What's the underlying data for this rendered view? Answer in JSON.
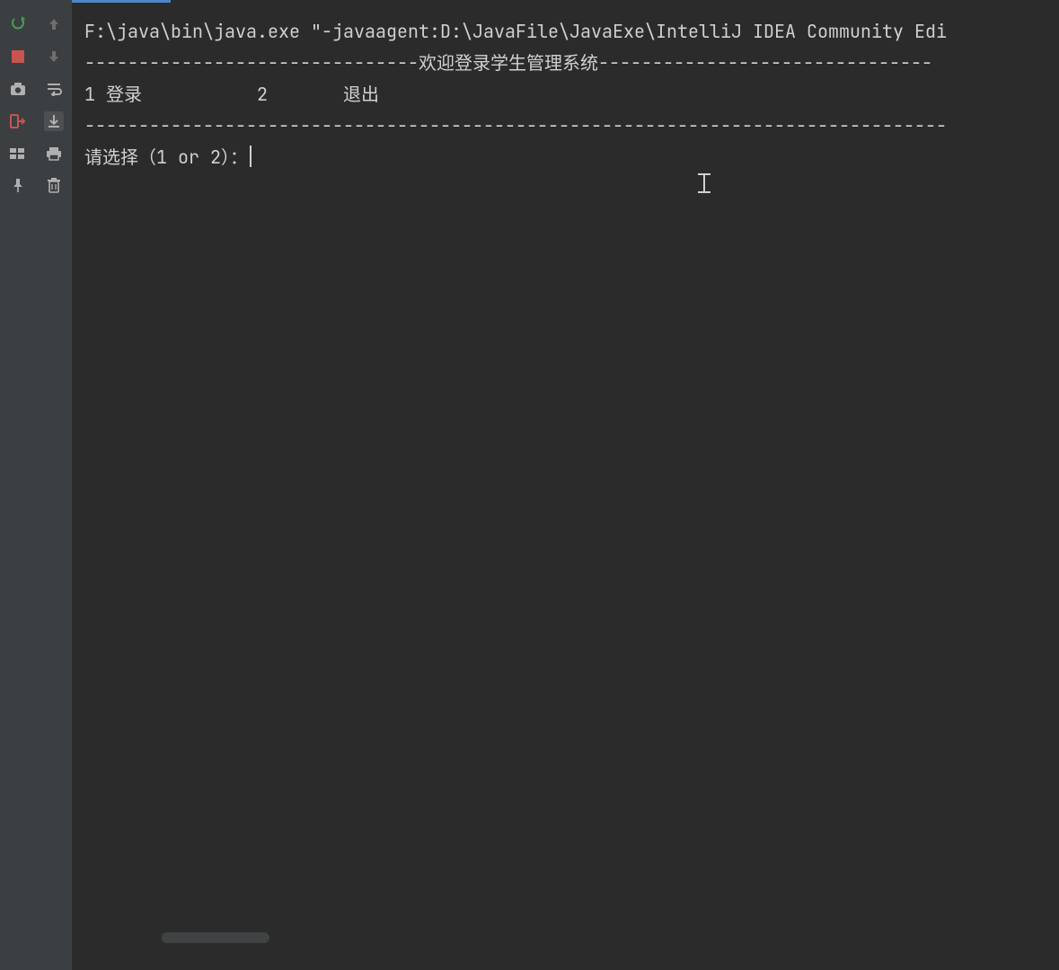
{
  "toolbar_left": {
    "rerun": "rerun-icon",
    "stop": "stop-icon",
    "camera": "camera-icon",
    "exit": "exit-icon",
    "layout": "layout-icon",
    "pin": "pin-icon"
  },
  "toolbar_secondary": {
    "up": "arrow-up-icon",
    "down": "arrow-down-icon",
    "wrap": "soft-wrap-icon",
    "scroll_end": "scroll-to-end-icon",
    "print": "print-icon",
    "trash": "trash-icon"
  },
  "console": {
    "command_line": "F:\\java\\bin\\java.exe \"-javaagent:D:\\JavaFile\\JavaExe\\IntelliJ IDEA Community Edi",
    "banner": "-------------------------------欢迎登录学生管理系统-------------------------------",
    "menu_line": "1 登录\t\t2\t退出",
    "divider": "--------------------------------------------------------------------------------",
    "prompt": "请选择（1 or 2）："
  },
  "colors": {
    "bg": "#2b2b2b",
    "panel": "#3c3f41",
    "text": "#d0d0d0",
    "accent": "#4a88c7",
    "stop_red": "#c75450",
    "run_green": "#499c54",
    "muted": "#6e6e6e"
  }
}
